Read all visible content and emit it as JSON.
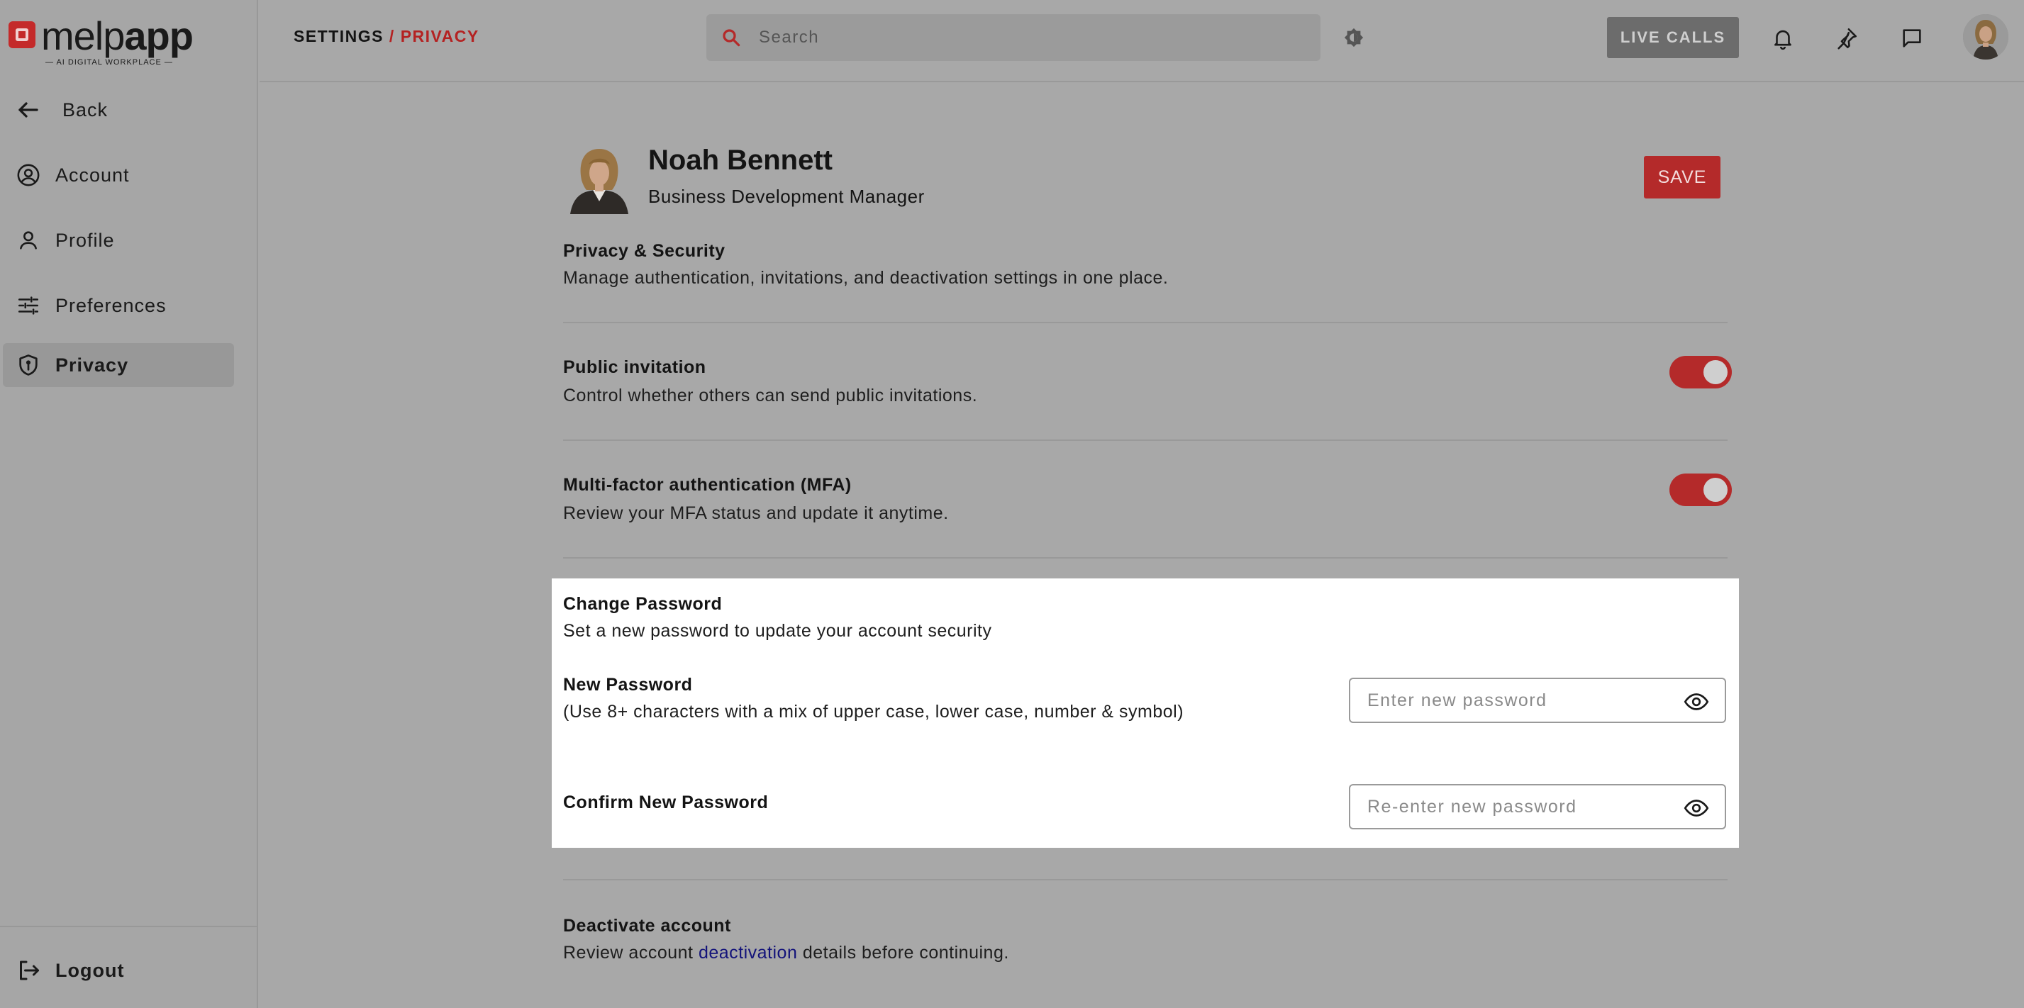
{
  "brand": {
    "name_light": "melp",
    "name_bold": "app",
    "tagline": "— AI DIGITAL WORKPLACE —"
  },
  "header": {
    "breadcrumb_root": "SETTINGS",
    "breadcrumb_sep": " / ",
    "breadcrumb_current": "PRIVACY",
    "search_placeholder": "Search",
    "live_calls": "LIVE CALLS"
  },
  "sidebar": {
    "back": "Back",
    "items": [
      {
        "label": "Account",
        "icon": "account-circle-icon"
      },
      {
        "label": "Profile",
        "icon": "person-icon"
      },
      {
        "label": "Preferences",
        "icon": "sliders-icon"
      },
      {
        "label": "Privacy",
        "icon": "shield-icon",
        "active": true
      }
    ],
    "logout": "Logout"
  },
  "profile": {
    "name": "Noah Bennett",
    "role": "Business Development Manager",
    "save": "SAVE"
  },
  "privacy": {
    "title": "Privacy & Security",
    "description": "Manage authentication, invitations, and deactivation settings in one place."
  },
  "public_invitation": {
    "title": "Public invitation",
    "description": "Control whether others can send public invitations.",
    "enabled": true
  },
  "mfa": {
    "title": "Multi-factor authentication (MFA)",
    "description": "Review your MFA status and update it anytime.",
    "enabled": true
  },
  "change_password": {
    "title": "Change Password",
    "description": "Set a new password to update your account security",
    "new_label": "New Password",
    "new_hint": "(Use 8+ characters with a mix of upper case, lower case, number & symbol)",
    "new_placeholder": "Enter new password",
    "confirm_label": "Confirm New Password",
    "confirm_placeholder": "Re-enter new password"
  },
  "deactivate": {
    "title": "Deactivate account",
    "desc_before": "Review account ",
    "desc_link": "deactivation",
    "desc_after": " details before continuing."
  },
  "colors": {
    "accent": "#b42a2a",
    "link": "#13137a",
    "overlay_bg": "#a8a8a8",
    "card_bg": "#ffffff"
  }
}
